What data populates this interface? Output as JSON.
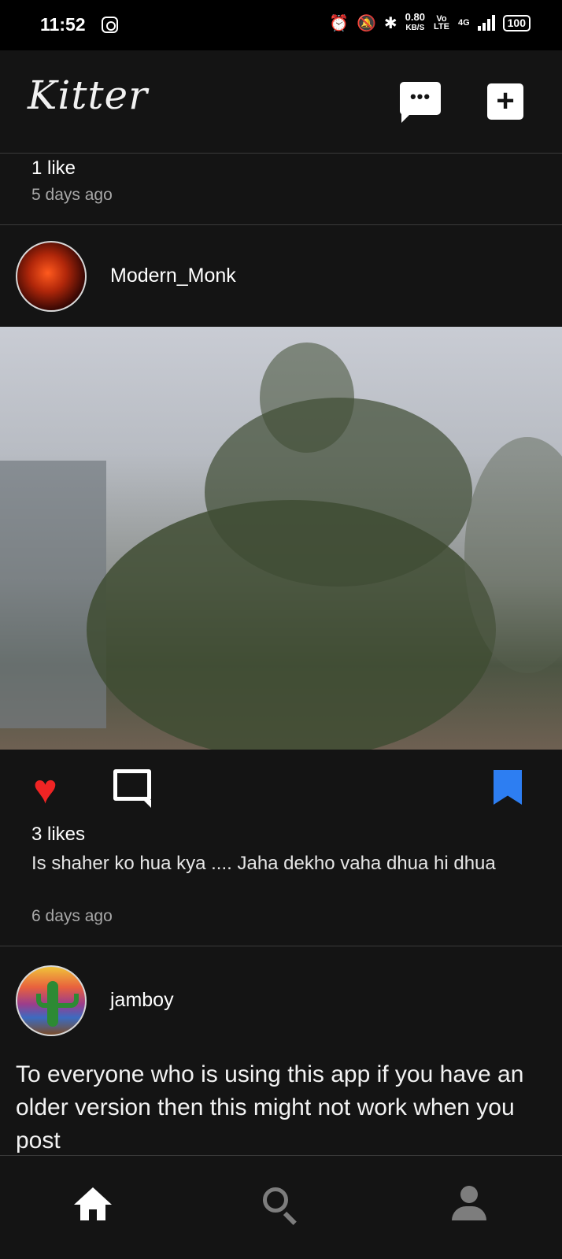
{
  "status_bar": {
    "time": "11:52",
    "speed_value": "0.80",
    "speed_unit": "KB/S",
    "volte": "Vo LTE",
    "network": "4G",
    "battery": "100"
  },
  "header": {
    "app_name": "Kitter",
    "icons": [
      "chat-icon",
      "add-post-icon"
    ]
  },
  "feed": {
    "previous_post": {
      "likes": "1 like",
      "time": "5 days ago"
    },
    "posts": [
      {
        "username": "Modern_Monk",
        "image_subject": "foggy tree",
        "likes": "3 likes",
        "caption": "Is shaher ko hua kya .... Jaha dekho vaha dhua hi dhua",
        "time": "6 days ago",
        "liked": true,
        "saved": true
      },
      {
        "username": "jamboy",
        "text": "To everyone who is using this app if you have an older version then this might not work when you post"
      }
    ]
  },
  "bottom_nav": {
    "items": [
      "home-icon",
      "search-icon",
      "profile-icon"
    ],
    "active": "home"
  },
  "colors": {
    "background": "#141414",
    "like_red": "#f02424",
    "save_blue": "#2d7ef2",
    "muted_text": "#a8a8a8"
  }
}
